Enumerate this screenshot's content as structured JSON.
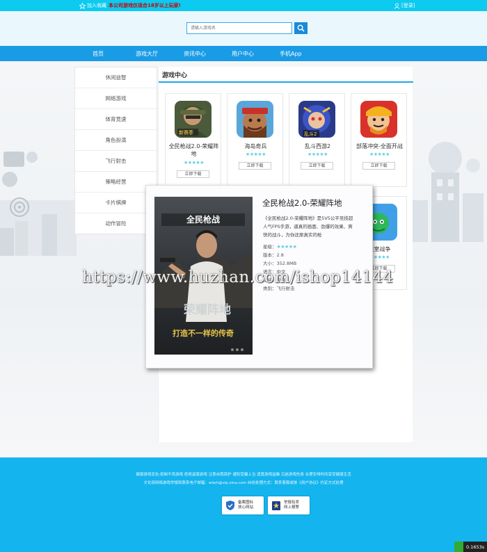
{
  "topbar": {
    "favorite_label": "加入收藏",
    "notice": "本公司游戏仅适合18岁以上玩家!",
    "login_label": "[登录]"
  },
  "search": {
    "placeholder": "请输入游戏名"
  },
  "nav": {
    "items": [
      "首页",
      "游戏大厅",
      "资讯中心",
      "用户中心",
      "手机App"
    ]
  },
  "sidebar": {
    "categories": [
      "休闲益智",
      "网络游戏",
      "体育竞速",
      "角色扮演",
      "飞行射击",
      "策略经营",
      "卡片棋牌",
      "动作冒险"
    ]
  },
  "main": {
    "title": "游戏中心",
    "download_label": "立即下载",
    "stars": "★★★★★",
    "games": [
      {
        "name": "全民枪战2.0-荣耀阵地"
      },
      {
        "name": "海岛奇兵"
      },
      {
        "name": "乱斗西游2"
      },
      {
        "name": "部落冲突-全面开战"
      },
      {
        "name": "皇室战争"
      }
    ]
  },
  "popup": {
    "title": "全民枪战2.0-荣耀阵地",
    "description": "《全民枪战2.0-荣耀阵地》是5V5公平竞技超人气FPS手游，逼真的画面、劲爆的效果、爽快的战斗，为你还原真实的枪",
    "rating_label": "星级：",
    "rating_stars": "★★★★★",
    "version": "版本：2.8",
    "size": "大小：352.8MB",
    "language": "语言：中文",
    "platform": "支持：安卓",
    "category": "类别：飞行射击",
    "art_text_top": "荣耀阵地",
    "art_text_main": "全民枪战",
    "art_text_slogan": "打造不一样的传奇"
  },
  "watermark": "https://www.huzhan.com/ishop14144",
  "footer": {
    "line1": "健康游戏忠告:抵制不良游戏 拒绝盗版游戏 注意自我保护 谨防受骗上当 适度游戏益脑 沉迷游戏伤身 合理安排时间享受健康生活",
    "line2": "文化部网络游戏举报和联系电子邮箱：wlwh@vip.sina.com 纠纷处理方式：联系客服或依《用户协议》约定方式处理",
    "badge1": [
      "备案图标",
      "放心网站"
    ],
    "badge2": [
      "举报有奖",
      "网上报警"
    ]
  },
  "timer": "0.1653s",
  "colors": {
    "topbar": "#0ccaf0",
    "nav": "#1a9be6",
    "footer": "#14b4ee",
    "accent_line": "#1da8ea",
    "stars": "#5dcde0"
  }
}
